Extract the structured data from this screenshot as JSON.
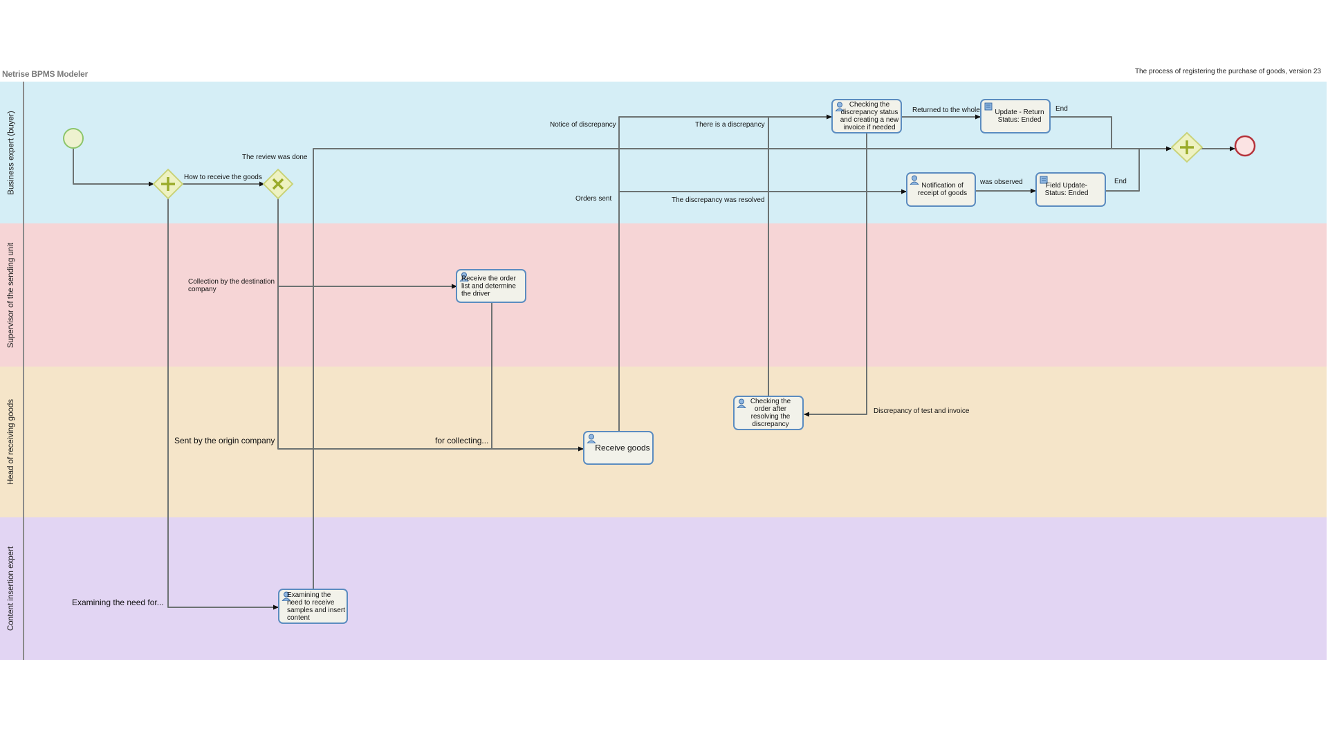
{
  "app": {
    "title": "Netrise BPMS Modeler",
    "process_title": "The process of registering the purchase of goods, version 23"
  },
  "colors": {
    "lane_buyer": "#d5eef6",
    "lane_sending": "#f6d5d6",
    "lane_receiving": "#f5e5c9",
    "lane_content": "#e2d5f3",
    "task_border": "#5b8cc0",
    "task_fill": "#f2f2ea",
    "gateway_fill": "#eef2c2",
    "gateway_mark": "#9aab2a",
    "start_stroke": "#8cc56b",
    "end_stroke": "#b5323a"
  },
  "lanes": [
    {
      "id": "buyer",
      "label": "Business expert (buyer)"
    },
    {
      "id": "sending",
      "label": "Supervisor of the sending unit"
    },
    {
      "id": "receiving",
      "label": "Head of receiving goods"
    },
    {
      "id": "content",
      "label": "Content insertion expert"
    }
  ],
  "tasks": {
    "receive_order_list": {
      "text": "Receive the order list and determine the driver",
      "type": "user"
    },
    "receive_goods": {
      "text": "Receive goods",
      "type": "user"
    },
    "checking_order_after": {
      "text": "Checking the order after resolving the discrepancy",
      "type": "user"
    },
    "checking_discrepancy_status": {
      "text": "Checking the discrepancy status and creating a new invoice if needed",
      "type": "user"
    },
    "update_return": {
      "text": "Update - Return Status: Ended",
      "type": "script"
    },
    "notification_receipt": {
      "text": "Notification of receipt of goods",
      "type": "user"
    },
    "field_update": {
      "text": "Field Update- Status: Ended",
      "type": "script"
    },
    "examining_need": {
      "text": "Examining the need to receive samples and insert content",
      "type": "user"
    }
  },
  "flow_labels": {
    "how_to_receive": "How to receive the goods",
    "review_done": "The review was done",
    "notice_discrepancy": "Notice of discrepancy",
    "orders_sent": "Orders sent",
    "there_is_discrepancy": "There is a discrepancy",
    "discrepancy_resolved": "The discrepancy was resolved",
    "returned_whole": "Returned to the whole",
    "end_1": "End",
    "was_observed": "was observed",
    "end_2": "End",
    "collection_destination": "Collection by the destination company",
    "sent_origin": "Sent by the origin company",
    "for_collecting": "for collecting...",
    "discrepancy_test_invoice": "Discrepancy of test and invoice",
    "examining_need_for": "Examining the need for..."
  }
}
